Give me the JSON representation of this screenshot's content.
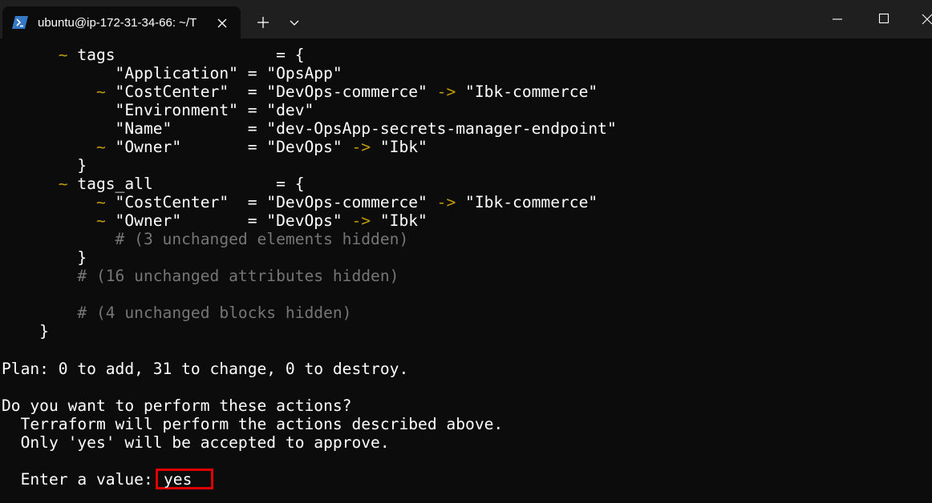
{
  "window": {
    "tab_title": "ubuntu@ip-172-31-34-66: ~/T",
    "tab_icon": "powershell-icon",
    "controls": [
      "minimize-icon",
      "maximize-icon",
      "close-icon"
    ]
  },
  "colors": {
    "background": "#0c0c0c",
    "text": "#cccccc",
    "bright_text": "#ffffff",
    "change_marker": "#c19c00",
    "comment": "#767676",
    "highlight_box": "#e00000"
  },
  "terminal": {
    "l01": "      ~ tags                 = {",
    "l02": "            \"Application\" = \"OpsApp\"",
    "l03": "          ~ \"CostCenter\"  = \"DevOps-commerce\" -> \"Ibk-commerce\"",
    "l04": "            \"Environment\" = \"dev\"",
    "l05": "            \"Name\"        = \"dev-OpsApp-secrets-manager-endpoint\"",
    "l06": "          ~ \"Owner\"       = \"DevOps\" -> \"Ibk\"",
    "l07": "        }",
    "l08": "      ~ tags_all             = {",
    "l09": "          ~ \"CostCenter\"  = \"DevOps-commerce\" -> \"Ibk-commerce\"",
    "l10": "          ~ \"Owner\"       = \"DevOps\" -> \"Ibk\"",
    "l11": "            # (3 unchanged elements hidden)",
    "l12": "        }",
    "l13": "        # (16 unchanged attributes hidden)",
    "l14": "        # (4 unchanged blocks hidden)",
    "l15": "    }",
    "plan": "Plan: 0 to add, 31 to change, 0 to destroy.",
    "question": "Do you want to perform these actions?",
    "info1": "  Terraform will perform the actions described above.",
    "info2": "  Only 'yes' will be accepted to approve.",
    "prompt": "  Enter a value:",
    "input_value": "yes"
  }
}
